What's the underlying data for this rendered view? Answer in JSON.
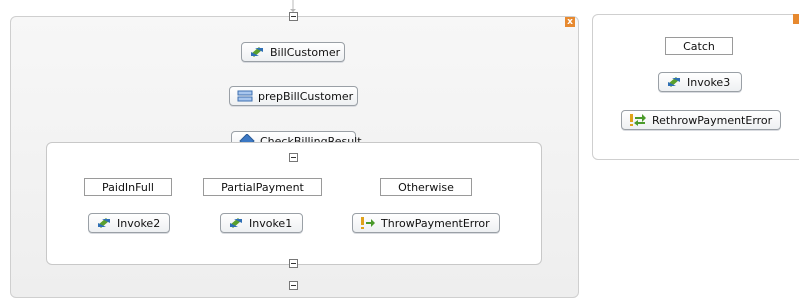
{
  "close_glyph": "x",
  "main_flow": {
    "nodes": [
      {
        "label": "BillCustomer",
        "icon": "invoke-icon"
      },
      {
        "label": "prepBillCustomer",
        "icon": "assign-icon"
      },
      {
        "label": "CheckBillingResult",
        "icon": "choice-icon"
      }
    ]
  },
  "choice": {
    "cases": [
      {
        "label": "PaidInFull",
        "node": {
          "label": "Invoke2",
          "icon": "invoke-icon"
        }
      },
      {
        "label": "PartialPayment",
        "node": {
          "label": "Invoke1",
          "icon": "invoke-icon"
        }
      },
      {
        "label": "Otherwise",
        "node": {
          "label": "ThrowPaymentError",
          "icon": "throw-icon"
        }
      }
    ]
  },
  "handler": {
    "catch_label": "Catch",
    "nodes": [
      {
        "label": "Invoke3",
        "icon": "invoke-icon"
      },
      {
        "label": "RethrowPaymentError",
        "icon": "rethrow-icon"
      }
    ]
  },
  "colors": {
    "accent_orange": "#e7892f",
    "invoke_green": "#5aa02c",
    "invoke_blue": "#2f6fb5"
  }
}
